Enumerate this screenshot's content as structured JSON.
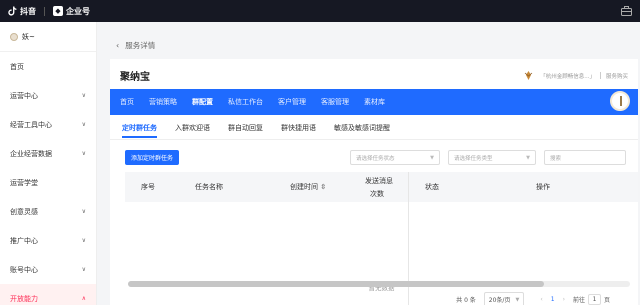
{
  "topbar": {
    "brand1": "抖音",
    "brand2": "企业号"
  },
  "user": {
    "name": "妖~"
  },
  "sidebar": {
    "items": [
      {
        "label": "首页",
        "chev": ""
      },
      {
        "label": "运营中心",
        "chev": "∨"
      },
      {
        "label": "经营工具中心",
        "chev": "∨"
      },
      {
        "label": "企业经营数据",
        "chev": "∨"
      },
      {
        "label": "运营学堂",
        "chev": ""
      },
      {
        "label": "创意灵感",
        "chev": "∨"
      },
      {
        "label": "推广中心",
        "chev": "∨"
      },
      {
        "label": "账号中心",
        "chev": "∨"
      },
      {
        "label": "开放能力",
        "chev": "∧"
      }
    ]
  },
  "breadcrumb": {
    "back": "‹",
    "label": "服务详情"
  },
  "panel": {
    "title": "聚纳宝",
    "shop_text": "「杭州金顾畅信息...」",
    "shop_link": "服务购买"
  },
  "bluebar": {
    "tabs": [
      "首页",
      "营销策略",
      "群配置",
      "私信工作台",
      "客户管理",
      "客服管理",
      "素材库"
    ]
  },
  "subtabs": [
    "定时群任务",
    "入群欢迎语",
    "群自动回复",
    "群快捷用语",
    "敏感及敏感词提醒"
  ],
  "toolbar": {
    "add_label": "添加定时群任务",
    "sel1": "请选择任务状态",
    "sel2": "请选择任务类型",
    "search": "搜索"
  },
  "table": {
    "columns": [
      "序号",
      "任务名称",
      "创建时间 ⇳",
      "发送消息",
      "次数",
      "状态",
      "操作"
    ],
    "empty": "暂无数据"
  },
  "pager": {
    "total": "共 0 条",
    "size": "20条/页",
    "prev": "‹",
    "page": "1",
    "next": "›",
    "goto": "前往",
    "goto_val": "1",
    "unit": "页"
  },
  "colors": {
    "accent": "#1f6bff",
    "brand_red": "#fe2c55",
    "topbar": "#161823"
  }
}
